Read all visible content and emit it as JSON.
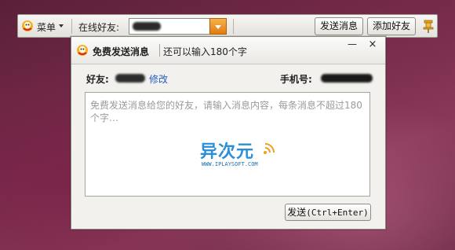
{
  "toolbar": {
    "menu_label": "菜单",
    "friend_label": "在线好友:",
    "send_message_label": "发送消息",
    "add_friend_label": "添加好友"
  },
  "dialog": {
    "title": "免费发送消息",
    "subtitle": "还可以输入180个字",
    "minimize_glyph": "—",
    "close_glyph": "×",
    "friend_label": "好友:",
    "edit_link": "修改",
    "phone_label": "手机号:",
    "message_placeholder": "免费发送消息给您的好友，请输入消息内容，每条消息不超过180个字…",
    "send_label": "发送",
    "send_shortcut": "(Ctrl+Enter)"
  },
  "watermark": {
    "name": "异次元",
    "url": "WWW.IPLAYSOFT.COM"
  },
  "colors": {
    "accent_orange": "#e88a18",
    "link_blue": "#1f5fbf",
    "watermark_blue": "#2a8fd8"
  },
  "icons": [
    "app-logo-icon",
    "chevron-down-icon",
    "pin-icon",
    "minimize-icon",
    "close-icon",
    "signal-icon"
  ]
}
